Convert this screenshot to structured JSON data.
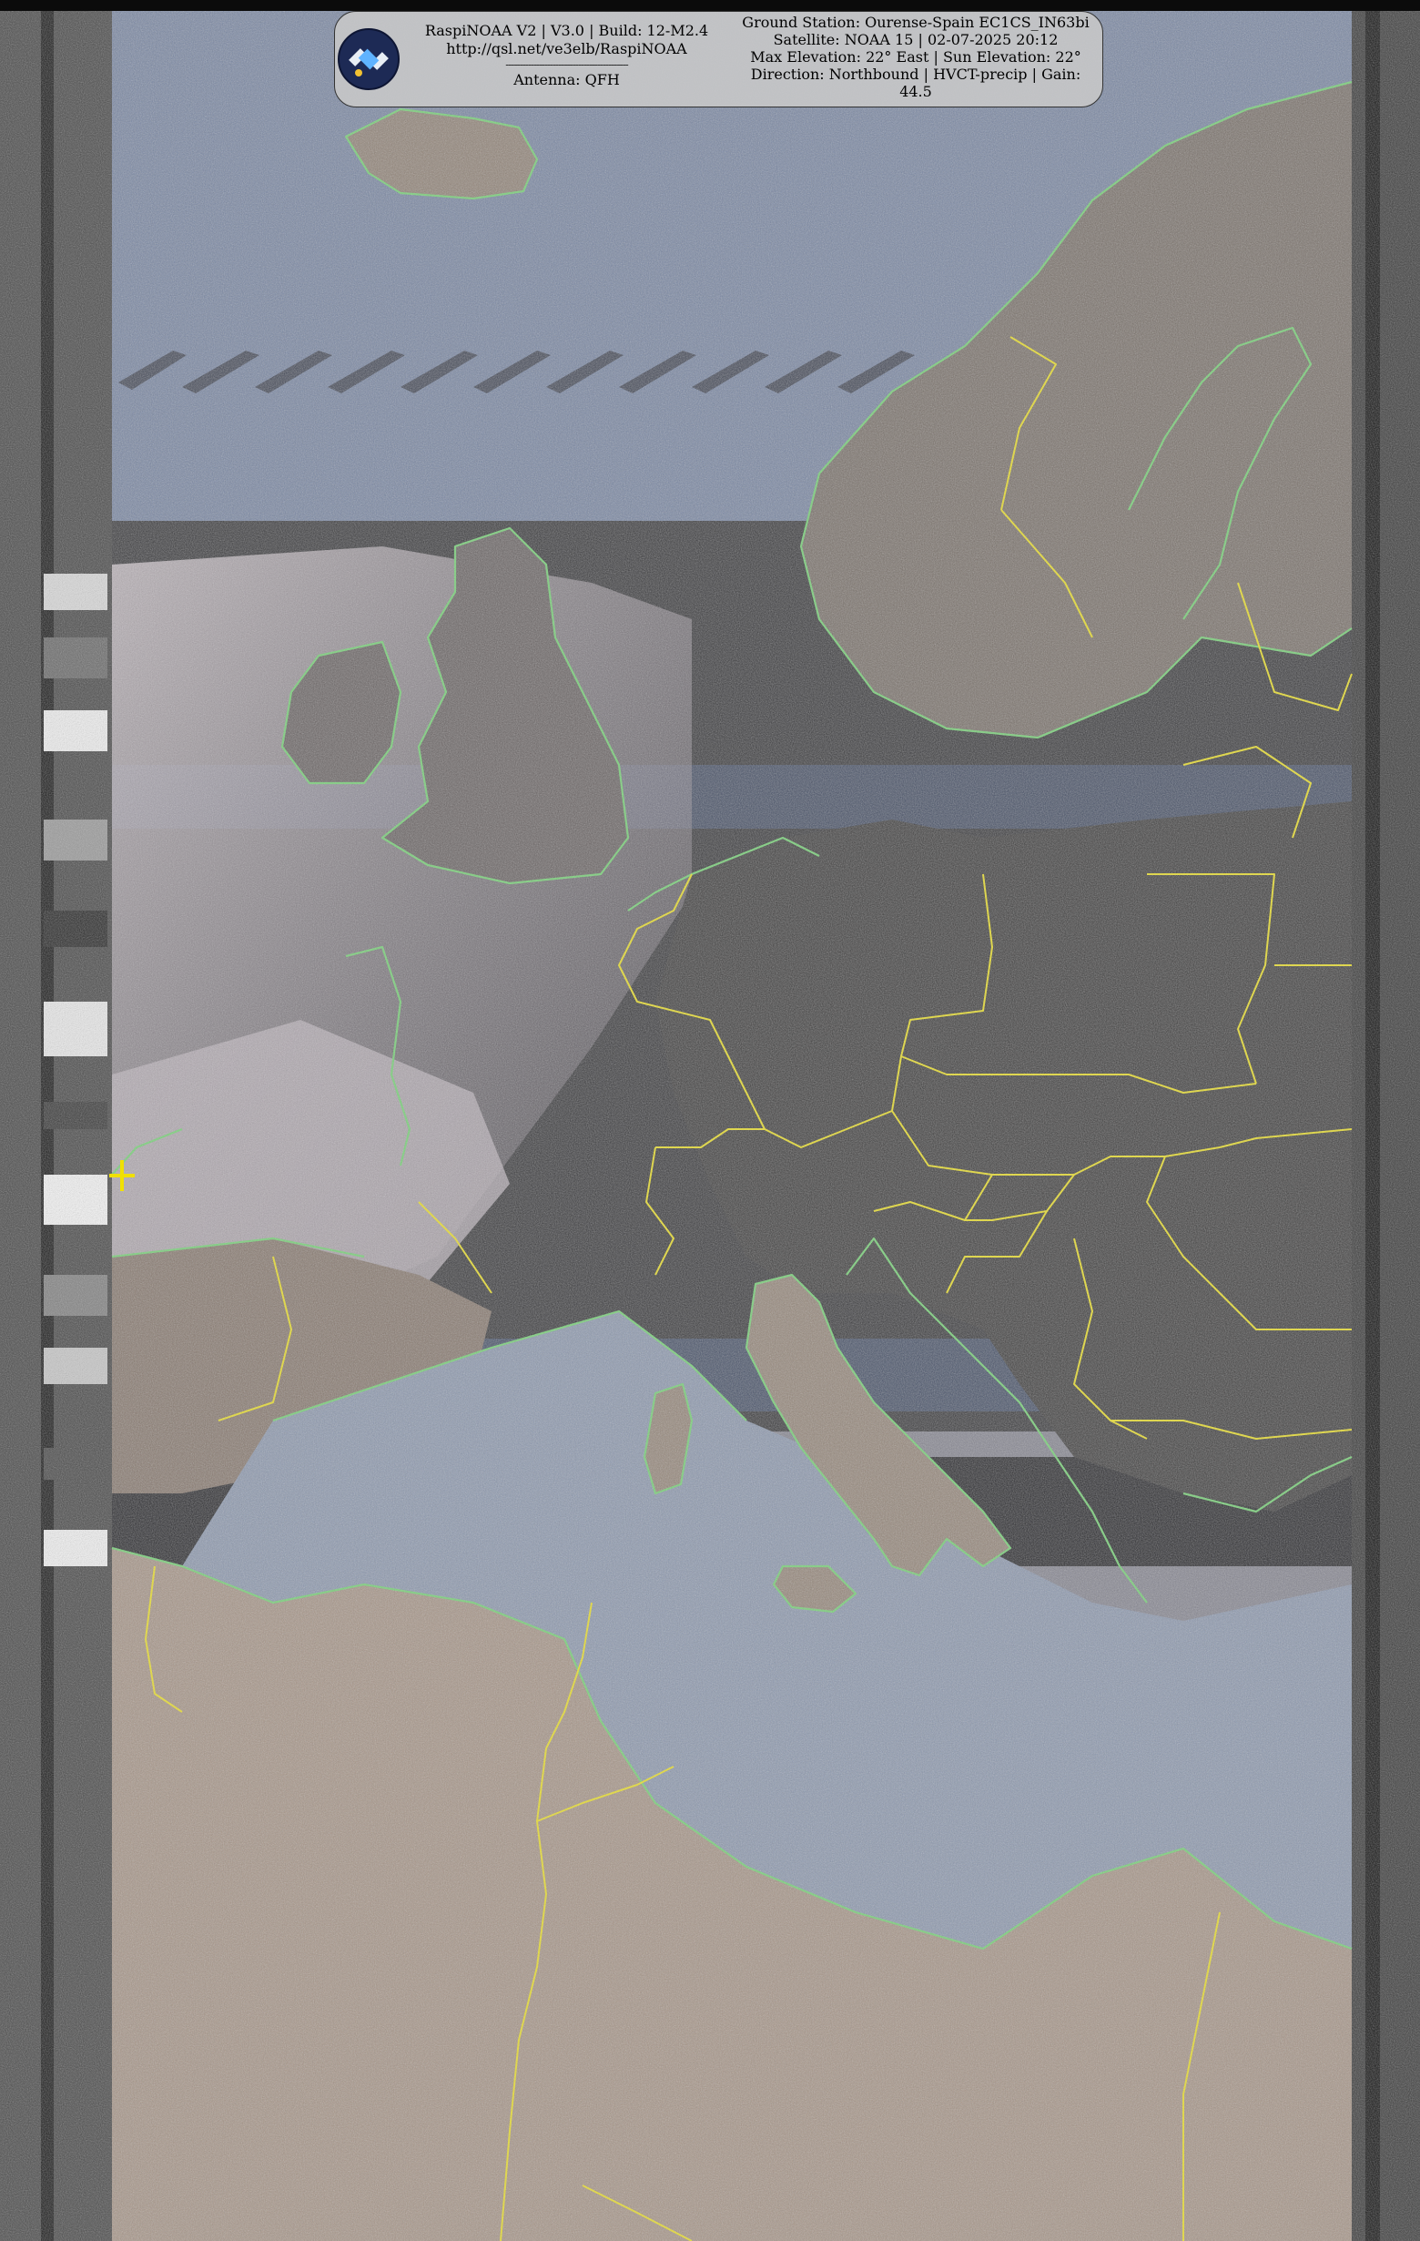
{
  "header": {
    "line1": "RaspiNOAA V2 | V3.0 | Build: 12-M2.4",
    "line2": "http://qsl.net/ve3elb/RaspiNOAA",
    "divider": "--------------------------------------------",
    "antenna": "Antenna: QFH"
  },
  "pass_info": {
    "ground_station": "Ground Station: Ourense-Spain EC1CS_IN63bi",
    "satellite": "Satellite: NOAA 15 | 02-07-2025 20:12",
    "elevation": "Max Elevation: 22° East | Sun Elevation: 22°",
    "direction": "Direction: Northbound | HVCT-precip | Gain:",
    "gain": "44.5"
  },
  "icons": {
    "logo": "satellite-logo-icon",
    "marker": "ground-station-cross-icon"
  },
  "colors": {
    "coastline": "#7fd07f",
    "borders": "#e6dc3a",
    "land": "#8d7a6a",
    "sea": "#4a5d85",
    "cloud": "#c9c0c7",
    "marker": "#f0e000"
  }
}
